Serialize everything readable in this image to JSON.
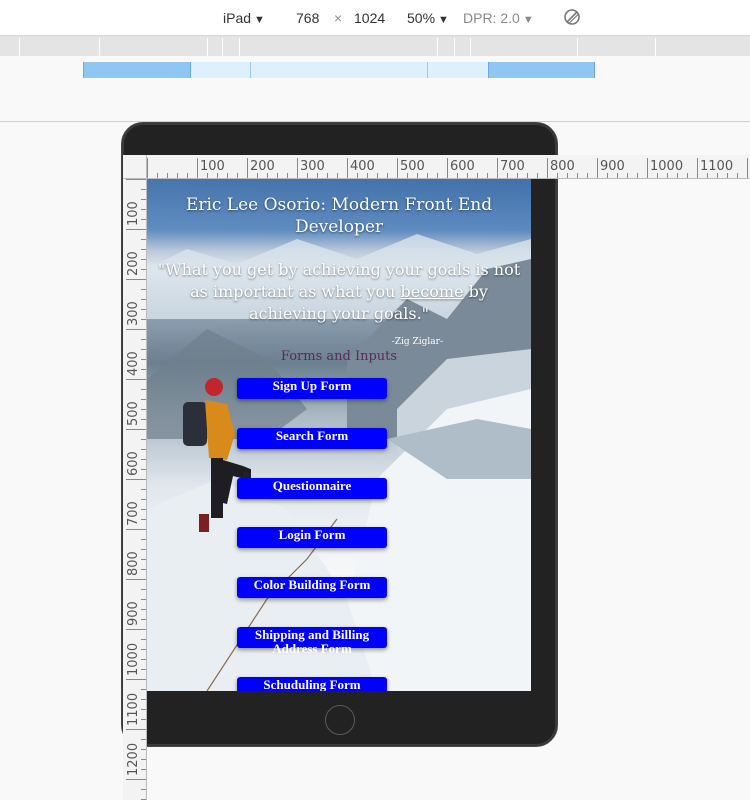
{
  "toolbar": {
    "device_name": "iPad",
    "width": "768",
    "times": "×",
    "height": "1024",
    "zoom": "50%",
    "dpr": "DPR: 2.0"
  },
  "ruler_h": [
    "100",
    "200",
    "300",
    "400",
    "500",
    "600",
    "700",
    "800",
    "900",
    "1000",
    "1100"
  ],
  "ruler_v": [
    "100",
    "200",
    "300",
    "400",
    "500",
    "600",
    "700",
    "800",
    "900",
    "1000",
    "1100",
    "1200"
  ],
  "page": {
    "title": "Eric Lee Osorio: Modern Front End Developer",
    "quote_before": "\"What you get by achieving your goals is not as important as what you ",
    "quote_underlined": "become",
    "quote_after": " by achieving your goals.\"",
    "attribution": "-Zig Ziglar-",
    "section_heading": "Forms and Inputs",
    "buttons": [
      "Sign Up Form",
      "Search Form",
      "Questionnaire",
      "Login Form",
      "Color Building Form",
      "Shipping and Billing Address Form",
      "Schuduling Form"
    ]
  },
  "colors": {
    "button_bg": "#0000ff",
    "device_frame": "#222222"
  }
}
